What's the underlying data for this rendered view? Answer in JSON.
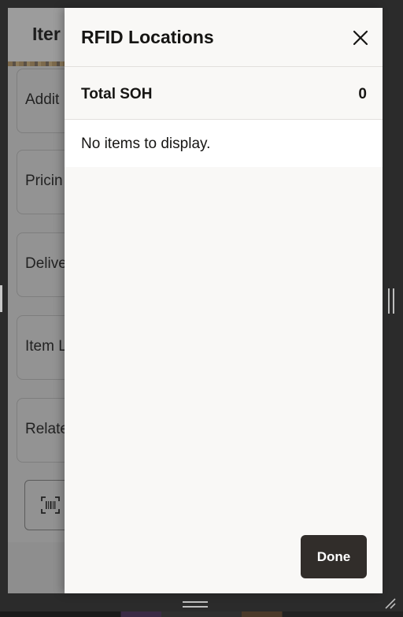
{
  "app": {
    "title": "Iter",
    "cards": [
      {
        "label": "Addit"
      },
      {
        "label": "Pricin"
      },
      {
        "label": "Delive"
      },
      {
        "label": "Item L"
      },
      {
        "label": "Relate"
      }
    ],
    "scan_icon": "barcode-scan-icon"
  },
  "drawer": {
    "title": "RFID Locations",
    "close_icon": "close-icon",
    "total_label": "Total SOH",
    "total_value": "0",
    "empty_message": "No items to display.",
    "done_label": "Done"
  },
  "colors": {
    "drawer_bg": "#f9f8f6",
    "done_bg": "#312d2a",
    "text": "#161513"
  }
}
